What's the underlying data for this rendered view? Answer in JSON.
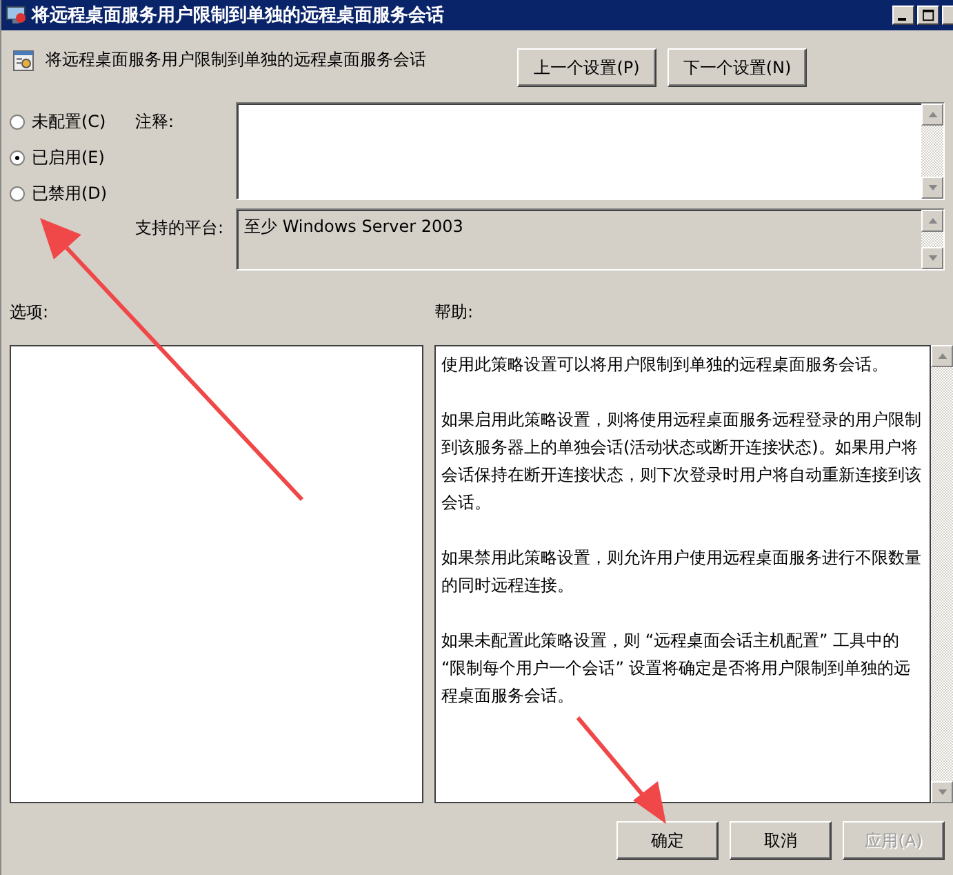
{
  "window": {
    "title": "将远程桌面服务用户限制到单独的远程桌面服务会话"
  },
  "header": {
    "title": "将远程桌面服务用户限制到单独的远程桌面服务会话"
  },
  "nav_buttons": [
    {
      "label": "上一个设置(P)",
      "disabled": false
    },
    {
      "label": "下一个设置(N)",
      "disabled": false
    }
  ],
  "radios": [
    {
      "label": "未配置(C)",
      "selected": false
    },
    {
      "label": "已启用(E)",
      "selected": true
    },
    {
      "label": "已禁用(D)",
      "selected": false
    }
  ],
  "comment": {
    "label": "注释:"
  },
  "platform": {
    "label": "支持的平台:",
    "value": "至少 Windows Server 2003"
  },
  "options": {
    "label": "选项:"
  },
  "help": {
    "label": "帮助:",
    "paragraphs": [
      "使用此策略设置可以将用户限制到单独的远程桌面服务会话。",
      "如果启用此策略设置，则将使用远程桌面服务远程登录的用户限制到该服务器上的单独会话(活动状态或断开连接状态)。如果用户将会话保持在断开连接状态，则下次登录时用户将自动重新连接到该会话。",
      "如果禁用此策略设置，则允许用户使用远程桌面服务进行不限数量的同时远程连接。",
      "如果未配置此策略设置，则 “远程桌面会话主机配置” 工具中的 “限制每个用户一个会话” 设置将确定是否将用户限制到单独的远程桌面服务会话。"
    ]
  },
  "buttons": [
    {
      "label": "确定",
      "disabled": false
    },
    {
      "label": "取消",
      "disabled": false
    },
    {
      "label": "应用(A)",
      "disabled": true
    }
  ]
}
